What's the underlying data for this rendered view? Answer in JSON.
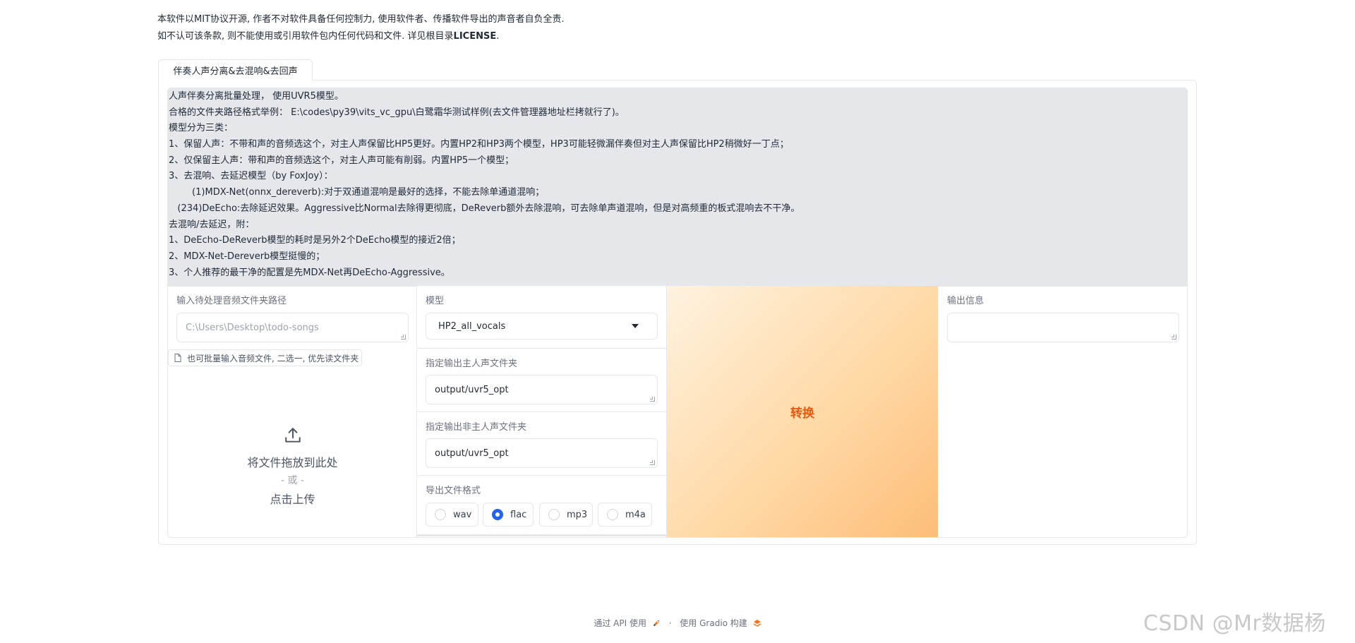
{
  "disclaimer": {
    "line1": "本软件以MIT协议开源, 作者不对软件具备任何控制力, 使用软件者、传播软件导出的声音者自负全责.",
    "line2_prefix": "如不认可该条款, 则不能使用或引用软件包内任何代码和文件. 详见根目录",
    "line2_bold": "LICENSE",
    "line2_suffix": "."
  },
  "tab": {
    "label": "伴奏人声分离&去混响&去回声"
  },
  "info_lines": [
    "人声伴奏分离批量处理， 使用UVR5模型。",
    "合格的文件夹路径格式举例： E:\\codes\\py39\\vits_vc_gpu\\白鹭霜华测试样例(去文件管理器地址栏拷就行了)。",
    "模型分为三类：",
    "1、保留人声：不带和声的音频选这个，对主人声保留比HP5更好。内置HP2和HP3两个模型，HP3可能轻微漏伴奏但对主人声保留比HP2稍微好一丁点；",
    "2、仅保留主人声：带和声的音频选这个，对主人声可能有削弱。内置HP5一个模型；",
    "3、去混响、去延迟模型（by FoxJoy）：",
    "        (1)MDX-Net(onnx_dereverb):对于双通道混响是最好的选择，不能去除单通道混响；",
    "   (234)DeEcho:去除延迟效果。Aggressive比Normal去除得更彻底，DeReverb额外去除混响，可去除单声道混响，但是对高频重的板式混响去不干净。",
    "去混响/去延迟，附：",
    "1、DeEcho-DeReverb模型的耗时是另外2个DeEcho模型的接近2倍；",
    "2、MDX-Net-Dereverb模型挺慢的；",
    "3、个人推荐的最干净的配置是先MDX-Net再DeEcho-Aggressive。"
  ],
  "input_dir": {
    "label": "输入待处理音频文件夹路径",
    "placeholder": "C:\\Users\\Desktop\\todo-songs"
  },
  "upload": {
    "hint": "也可批量输入音频文件, 二选一, 优先读文件夹",
    "drop_text": "将文件拖放到此处",
    "or_text": "- 或 -",
    "click_text": "点击上传",
    "icon": "upload-icon"
  },
  "model": {
    "label": "模型",
    "value": "HP2_all_vocals"
  },
  "vocal_out": {
    "label": "指定输出主人声文件夹",
    "value": "output/uvr5_opt"
  },
  "ins_out": {
    "label": "指定输出非主人声文件夹",
    "value": "output/uvr5_opt"
  },
  "format": {
    "label": "导出文件格式",
    "options": [
      "wav",
      "flac",
      "mp3",
      "m4a"
    ],
    "selected": "flac"
  },
  "convert": {
    "label": "转换"
  },
  "output_info": {
    "label": "输出信息",
    "value": ""
  },
  "footer": {
    "api_text": "通过 API 使用",
    "separator": "·",
    "built_text": "使用 Gradio 构建"
  },
  "watermark": "CSDN @Mr数据杨",
  "colors": {
    "accent": "#e8590c",
    "radio": "#2563eb",
    "panel_bg": "#e5e7eb"
  }
}
